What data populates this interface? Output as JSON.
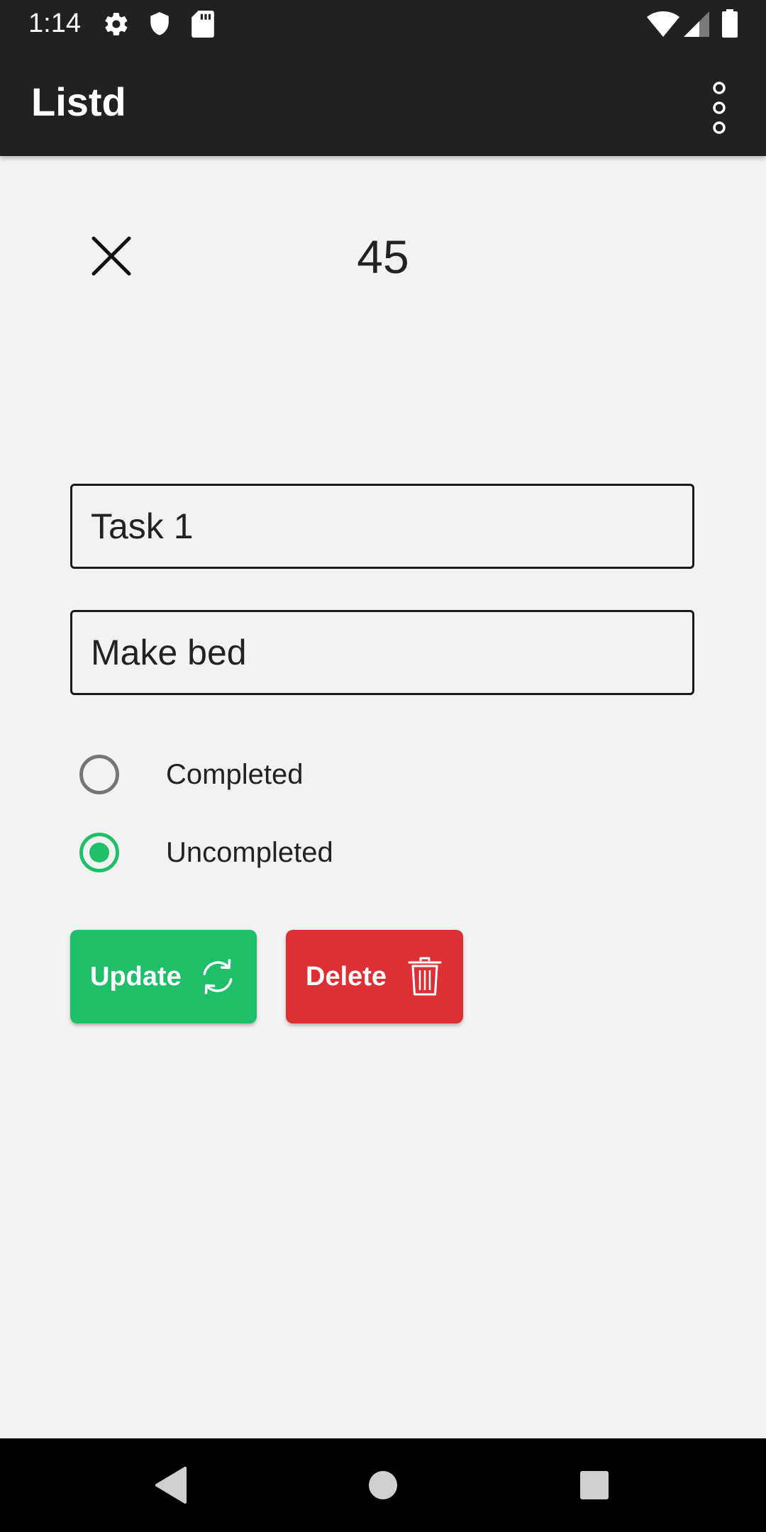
{
  "status_bar": {
    "time": "1:14",
    "icons": [
      "gear-icon",
      "shield-icon",
      "sd-card-icon",
      "wifi-icon",
      "signal-icon",
      "battery-icon"
    ]
  },
  "app_bar": {
    "title": "Listd",
    "overflow_icon": "more-vert-icon"
  },
  "task": {
    "id": "45",
    "title_value": "Task 1",
    "description_value": "Make bed"
  },
  "status_options": [
    {
      "label": "Completed",
      "selected": false
    },
    {
      "label": "Uncompleted",
      "selected": true
    }
  ],
  "actions": {
    "update_label": "Update",
    "update_icon": "refresh-icon",
    "delete_label": "Delete",
    "delete_icon": "trash-icon"
  },
  "nav_bar": {
    "icons": [
      "back-icon",
      "home-icon",
      "recents-icon"
    ]
  },
  "colors": {
    "bar_background": "#212121",
    "page_background": "#f2f2f2",
    "accent_green": "#1fbf69",
    "delete_red": "#dc3035"
  }
}
